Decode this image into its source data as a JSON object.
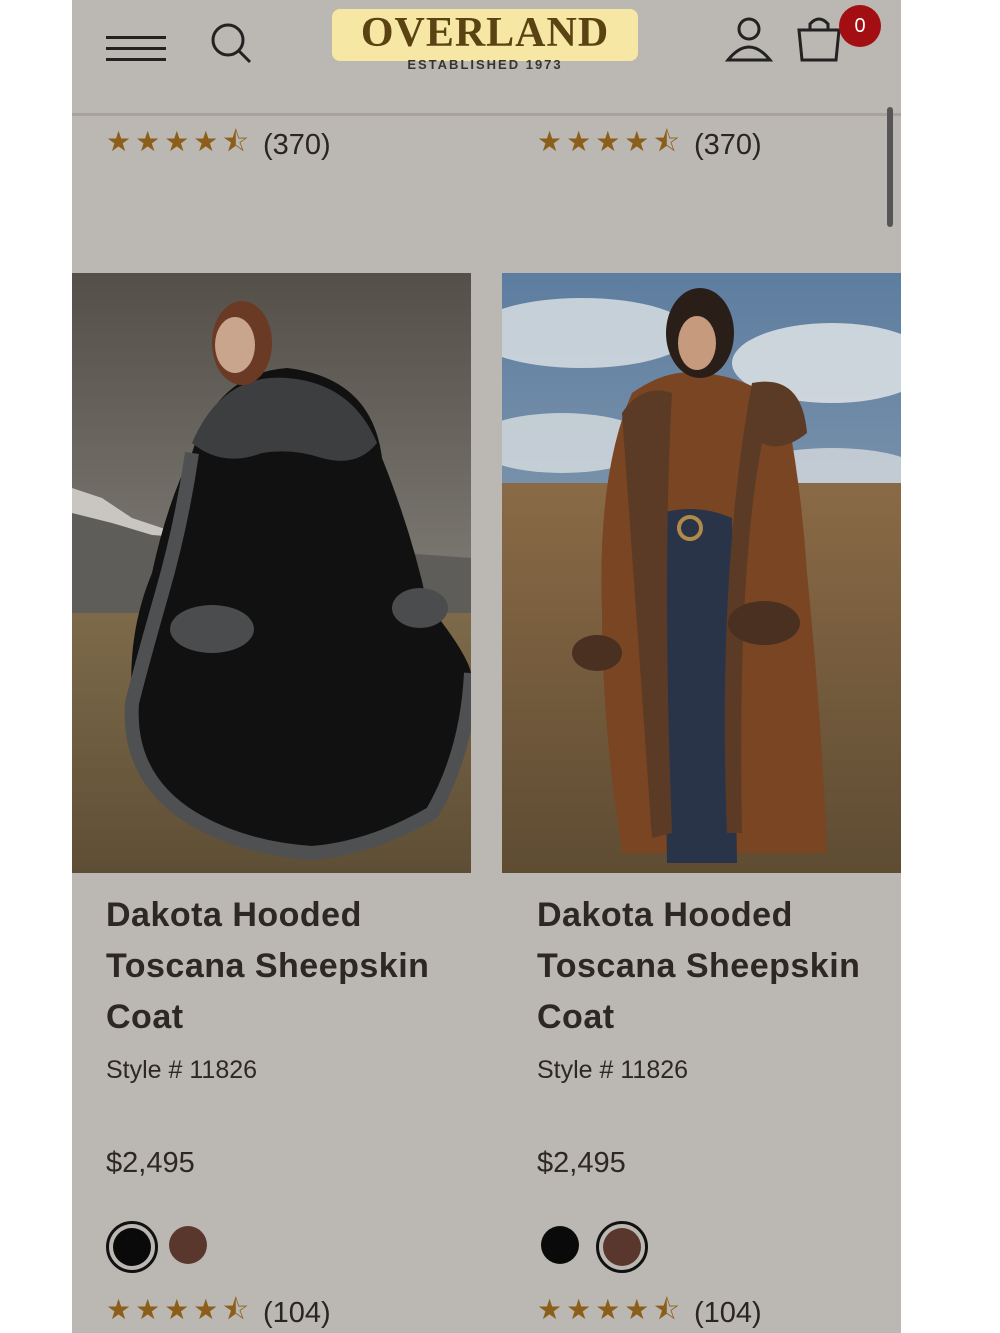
{
  "header": {
    "logo_text": "OVERLAND",
    "logo_tagline": "ESTABLISHED 1973",
    "cart_count": "0"
  },
  "top_ratings": [
    {
      "stars": "★★★★⯪",
      "count": "(370)"
    },
    {
      "stars": "★★★★⯪",
      "count": "(370)"
    }
  ],
  "products": [
    {
      "name": "Dakota Hooded Toscana Sheepskin Coat",
      "style": "Style # 11826",
      "price": "$2,495",
      "swatches": [
        {
          "color": "#0a0a0a",
          "selected": true
        },
        {
          "color": "#5a372c",
          "selected": false
        }
      ],
      "rating": {
        "stars": "★★★★⯪",
        "count": "(104)"
      }
    },
    {
      "name": "Dakota Hooded Toscana Sheepskin Coat",
      "style": "Style # 11826",
      "price": "$2,495",
      "swatches": [
        {
          "color": "#0a0a0a",
          "selected": false
        },
        {
          "color": "#5a372c",
          "selected": true
        }
      ],
      "rating": {
        "stars": "★★★★⯪",
        "count": "(104)"
      }
    }
  ],
  "colors": {
    "background": "#bbb7b3",
    "star": "#8b5f19",
    "badge": "#a30e12",
    "logo_bg": "#f6e7a4"
  }
}
